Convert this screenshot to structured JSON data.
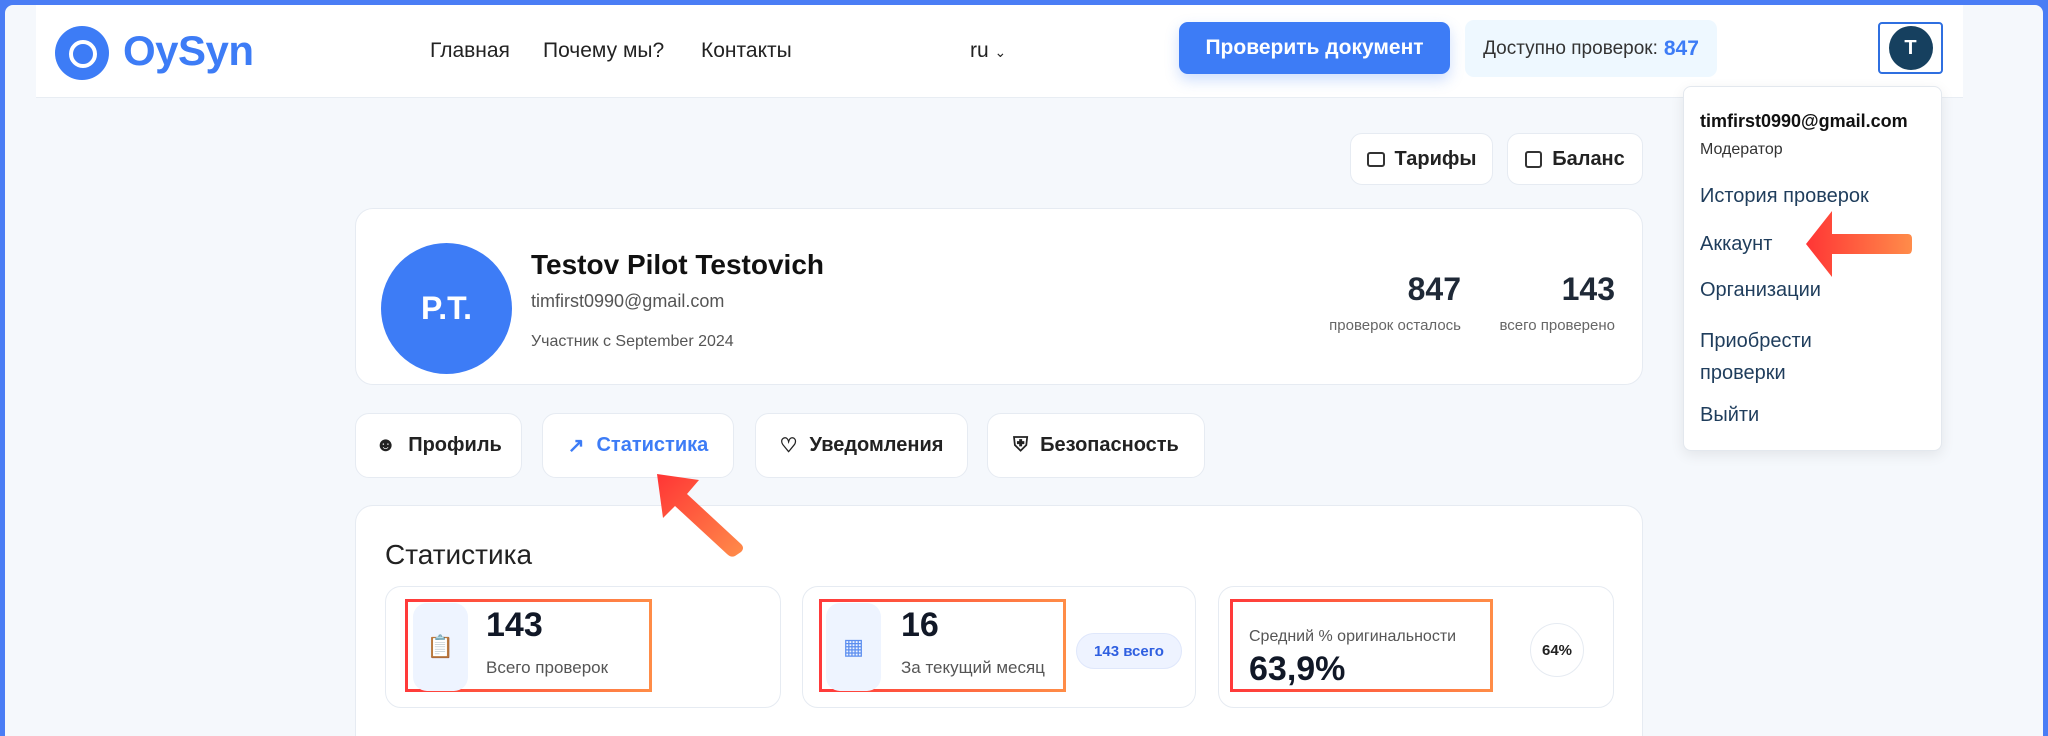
{
  "header": {
    "logo": "OySyn",
    "nav": [
      "Главная",
      "Почему мы?",
      "Контакты"
    ],
    "lang": "ru",
    "check_button": "Проверить документ",
    "available_label": "Доступно проверок:",
    "available_value": "847",
    "avatar_initial": "T"
  },
  "menu": {
    "email": "timfirst0990@gmail.com",
    "role": "Модератор",
    "items": [
      "История проверок",
      "Аккаунт",
      "Организации",
      "Приобрести",
      "проверки",
      "Выйти"
    ]
  },
  "actions": {
    "tariffs": "Тарифы",
    "balance": "Баланс"
  },
  "profile": {
    "initials": "P.T.",
    "name": "Testov Pilot Testovich",
    "email": "timfirst0990@gmail.com",
    "member_since": "Участник с September 2024",
    "remaining_value": "847",
    "remaining_label": "проверок осталось",
    "total_value": "143",
    "total_label": "всего проверено"
  },
  "tabs": [
    "Профиль",
    "Статистика",
    "Уведомления",
    "Безопасность"
  ],
  "stats": {
    "title": "Статистика",
    "total_value": "143",
    "total_label": "Всего проверок",
    "month_value": "16",
    "month_label": "За текущий месяц",
    "month_badge": "143 всего",
    "orig_label": "Средний % оригинальности",
    "orig_value": "63,9%",
    "orig_badge": "64%"
  },
  "colors": {
    "accent": "#3d7cf6",
    "annotation": "#ff4a3a"
  }
}
